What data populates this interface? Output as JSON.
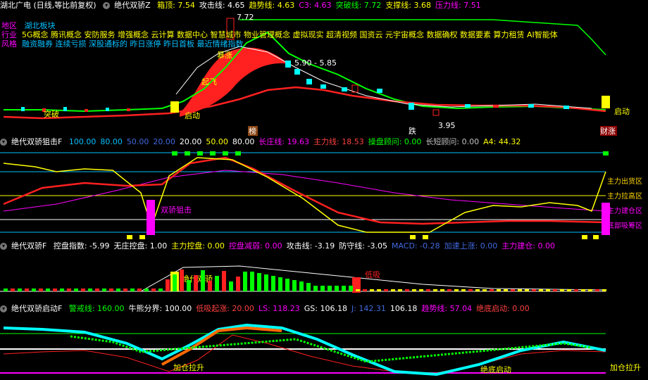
{
  "main": {
    "stock_title": "湖北广电 (日线,等比前复权)",
    "indicator_name": "绝代双骄Z",
    "readouts": [
      {
        "label": "箱顶:",
        "value": "7.54",
        "color": "#ffff00"
      },
      {
        "label": "攻击线:",
        "value": "4.65",
        "color": "#ffffff"
      },
      {
        "label": "趋势线:",
        "value": "4.63",
        "color": "#ffff00"
      },
      {
        "label": "C3:",
        "value": "4.63",
        "color": "#ff00ff"
      },
      {
        "label": "突破线:",
        "value": "7.72",
        "color": "#00ff00"
      },
      {
        "label": "支撑线:",
        "value": "3.68",
        "color": "#ffff00"
      },
      {
        "label": "压力线:",
        "value": "7.51",
        "color": "#ff00ff"
      }
    ],
    "info_rows": [
      {
        "key": "地区",
        "value": "湖北板块"
      },
      {
        "key": "行业",
        "value": "5G概念 腾讯概念 安防服务 增强概念 云计算 数据中心 智慧城市 物业管理概念 虚拟现实 超清视频 国资云 元宇宙概念 数据确权 数据要素 算力租赁 AI智能体"
      },
      {
        "key": "风格",
        "value": "融资融券 连续亏损 深股通标的 昨日涨停 昨日首板 最近情绪指数"
      }
    ],
    "price_labels": {
      "high": "7.72",
      "mid_range": "5.90 - 5.85",
      "low": "3.95"
    },
    "markers": {
      "bottom1": "榜",
      "bottom2": "跌",
      "bottom3": "财涨",
      "breakout": "突破",
      "surge": "暴涨",
      "rise": "起飞",
      "launch": "启动",
      "right_launch": "启动"
    }
  },
  "pane2": {
    "indicator_name": "绝代双骄狙击F",
    "readouts": [
      {
        "label": "",
        "value": "100.00",
        "color": "#00bfff"
      },
      {
        "label": "",
        "value": "80.00",
        "color": "#00bfff"
      },
      {
        "label": "",
        "value": "50.00",
        "color": "#4169e1"
      },
      {
        "label": "",
        "value": "20.00",
        "color": "#4169e1"
      },
      {
        "label": "",
        "value": "20.00",
        "color": "#ffffff"
      },
      {
        "label": "",
        "value": "50.00",
        "color": "#ffff00"
      },
      {
        "label": "",
        "value": "80.00",
        "color": "#ffffff"
      },
      {
        "label": "长庄线:",
        "value": "19.63",
        "color": "#ff00ff"
      },
      {
        "label": "主力线:",
        "value": "18.53",
        "color": "#ff4040"
      },
      {
        "label": "操盘顾问:",
        "value": "0.00",
        "color": "#00ff00"
      },
      {
        "label": "长短顾问:",
        "value": "0.00",
        "color": "#c0c0c0"
      },
      {
        "label": "A4:",
        "value": "44.32",
        "color": "#ffff00"
      }
    ],
    "signal": "双骄狙击",
    "right_labels": [
      "主力出货区",
      "主力拉高区",
      "主力建仓区",
      "底部吸筹区"
    ]
  },
  "pane3": {
    "indicator_name": "绝代双骄F",
    "readouts": [
      {
        "label": "控盘指数:",
        "value": "-5.99",
        "color": "#ffffff"
      },
      {
        "label": "无庄控盘:",
        "value": "1.00",
        "color": "#ffffff"
      },
      {
        "label": "主力控盘:",
        "value": "0.00",
        "color": "#ffff00"
      },
      {
        "label": "控盘减弱:",
        "value": "0.00",
        "color": "#ff00ff"
      },
      {
        "label": "攻击线:",
        "value": "-3.19",
        "color": "#ffffff"
      },
      {
        "label": "防守线:",
        "value": "-3.05",
        "color": "#ffffff"
      },
      {
        "label": "MACD:",
        "value": "-0.28",
        "color": "#4169e1"
      },
      {
        "label": "加速上涨:",
        "value": "0.00",
        "color": "#4169e1"
      },
      {
        "label": "主力建仓:",
        "value": "0.00",
        "color": "#ff00ff"
      }
    ],
    "signal_left": "绝代双骄",
    "signal_right": "低吸"
  },
  "pane4": {
    "indicator_name": "绝代双骄启动F",
    "readouts": [
      {
        "label": "警戒线:",
        "value": "160.00",
        "color": "#00ff00"
      },
      {
        "label": "牛熊分界:",
        "value": "100.00",
        "color": "#ffffff"
      },
      {
        "label": "低吸起涨:",
        "value": "20.00",
        "color": "#ff4040"
      },
      {
        "label": "LS:",
        "value": "118.23",
        "color": "#ff00ff"
      },
      {
        "label": "GS:",
        "value": "106.18",
        "color": "#ffffff"
      },
      {
        "label": "J:",
        "value": "142.31",
        "color": "#4169e1"
      },
      {
        "label": "",
        "value": "106.18",
        "color": "#ffffff"
      },
      {
        "label": "趋势线:",
        "value": "57.04",
        "color": "#ff00ff"
      },
      {
        "label": "绝底启动:",
        "value": "0.00",
        "color": "#ff4040"
      }
    ],
    "signal1": "加仓拉升",
    "signal2": "绝底启动",
    "signal3": "加仓拉升"
  }
}
